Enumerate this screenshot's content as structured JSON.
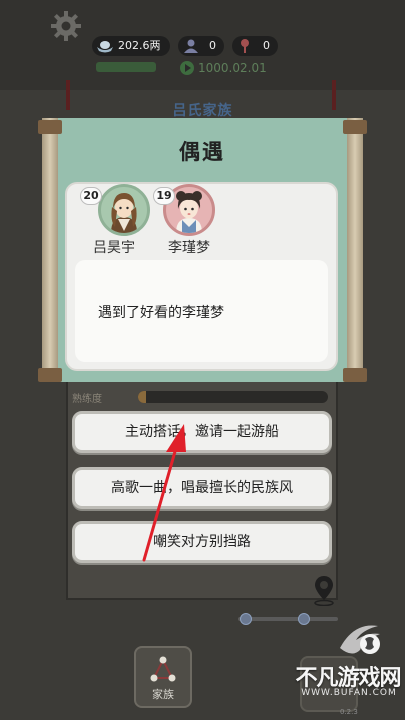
{
  "hud": {
    "money": "202.6两",
    "count_a": "0",
    "count_b": "0",
    "game_time": "1000.02.01"
  },
  "background": {
    "family_title": "吕氏家族",
    "skill_label": "熟练度",
    "skill_progress": 0.04,
    "nav_label": "家族"
  },
  "dialog": {
    "title": "偶遇",
    "characters": [
      {
        "name": "吕昊宇",
        "age": "20"
      },
      {
        "name": "李瑾梦",
        "age": "19"
      }
    ],
    "message": "遇到了好看的李瑾梦"
  },
  "choices": [
    "主动搭话，邀请一起游船",
    "高歌一曲，唱最擅长的民族风",
    "嘲笑对方别挡路"
  ],
  "watermark": {
    "name": "不凡游戏网",
    "url": "WWW.BUFAN.COM"
  },
  "version": "0.2.3",
  "colors": {
    "dialog_bg": "#97bfae",
    "annotation_arrow": "#e0202a"
  },
  "icons": [
    "gear-icon",
    "ingot-icon",
    "person-icon",
    "pin-icon",
    "play-icon",
    "family-tree-icon",
    "map-pin-icon"
  ]
}
